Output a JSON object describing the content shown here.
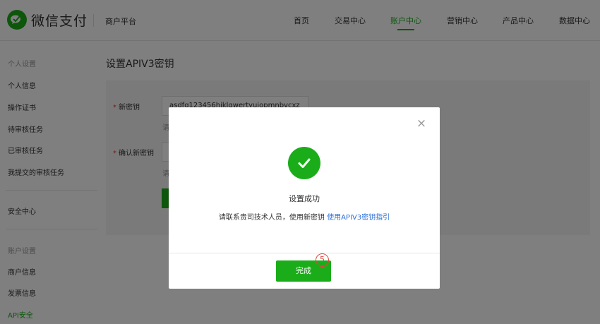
{
  "header": {
    "brand": "微信支付",
    "platform": "商户平台",
    "nav": [
      {
        "label": "首页",
        "active": false
      },
      {
        "label": "交易中心",
        "active": false
      },
      {
        "label": "账户中心",
        "active": true
      },
      {
        "label": "营销中心",
        "active": false
      },
      {
        "label": "产品中心",
        "active": false
      },
      {
        "label": "数据中心",
        "active": false
      }
    ]
  },
  "sidebar": {
    "group_personal": "个人设置",
    "items_personal": [
      "个人信息",
      "操作证书",
      "待审核任务",
      "已审核任务",
      "我提交的审核任务"
    ],
    "security": "安全中心",
    "group_account": "账户设置",
    "items_account": [
      "商户信息",
      "发票信息",
      "API安全"
    ]
  },
  "main": {
    "title": "设置APIV3密钥",
    "new_key_label": "新密钥",
    "new_key_value": "asdfg123456hjklqwertyuiopmnbvcxz",
    "hint1": "请",
    "confirm_label": "确认新密钥",
    "hint2": "请"
  },
  "modal": {
    "close": "×",
    "title": "设置成功",
    "desc": "请联系贵司技术人员，使用新密钥",
    "link": "使用APIV3密钥指引",
    "done": "完成",
    "step": "5"
  },
  "colors": {
    "brand_green": "#1aad19",
    "link_blue": "#2d6fd6",
    "marker_red": "#e64340"
  }
}
